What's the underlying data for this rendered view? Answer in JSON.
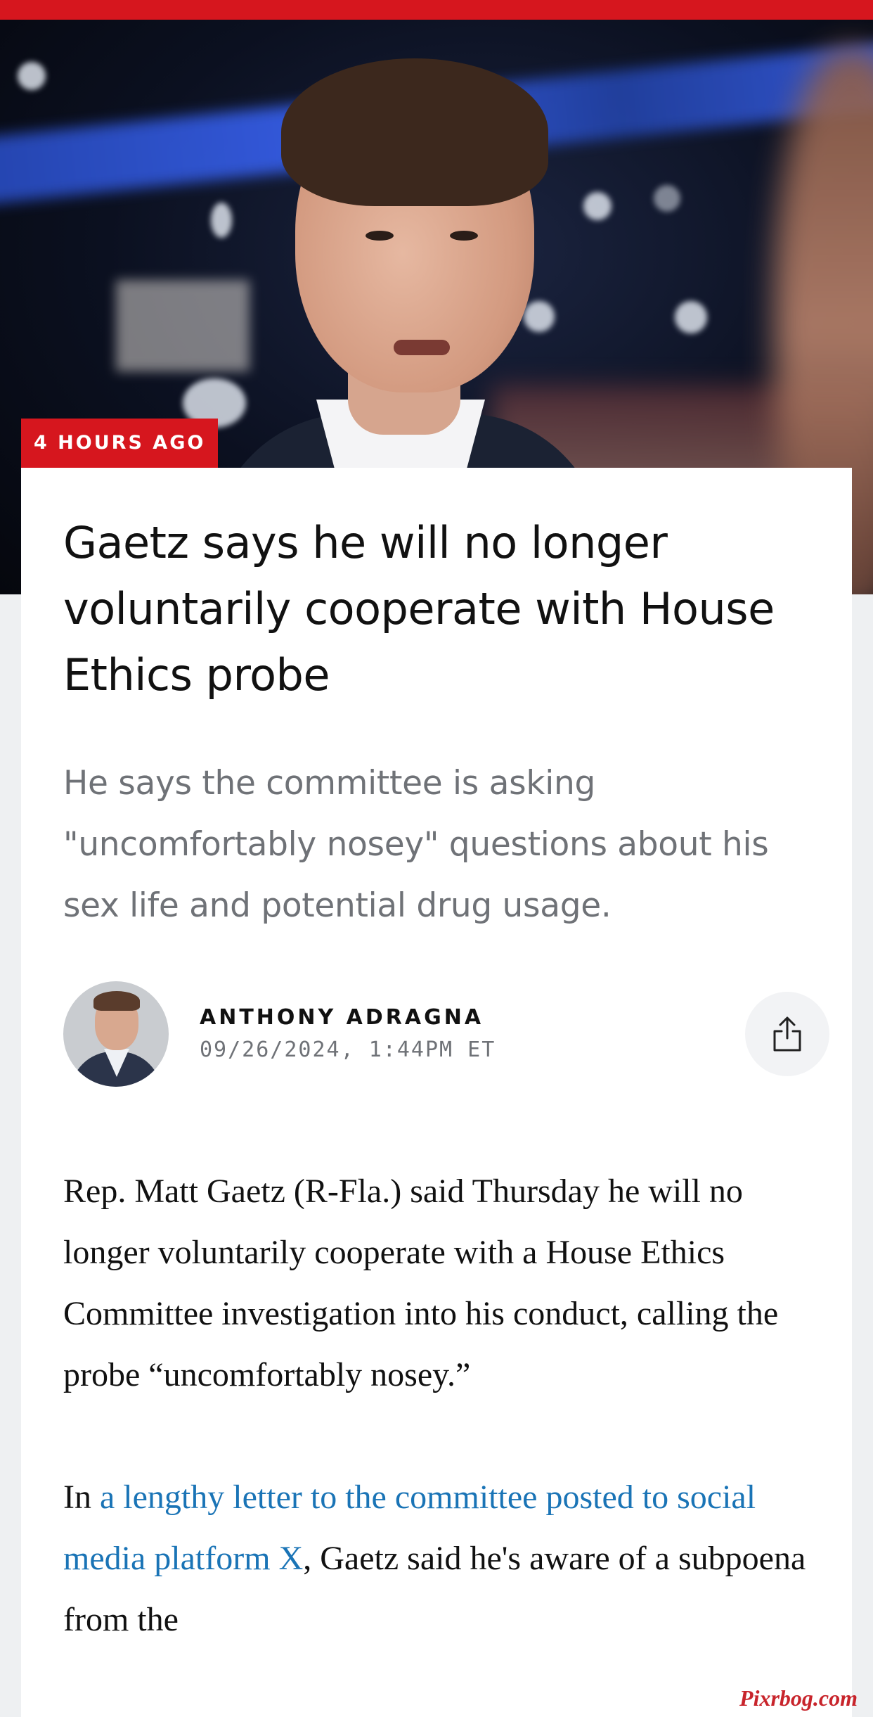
{
  "article": {
    "time_tag": "4 HOURS AGO",
    "headline": "Gaetz says he will no longer voluntarily cooperate with House Ethics probe",
    "subheadline": "He says the committee is asking \"uncomfortably nosey\" questions about his sex life and potential drug usage.",
    "author": {
      "name": "ANTHONY ADRAGNA",
      "date": "09/26/2024, 1:44PM ET",
      "avatar_icon": "author-photo"
    },
    "share_icon": "share-icon",
    "body": {
      "p1": "Rep. Matt Gaetz (R-Fla.) said Thursday he will no longer voluntarily cooperate with a House Ethics Committee investigation into his conduct, calling the probe “uncomfortably nosey.”",
      "p2_prefix": "In ",
      "p2_link": "a lengthy letter to the committee posted to social media platform X",
      "p2_suffix": ", Gaetz said he's aware of a subpoena from the"
    }
  },
  "watermark": "Pixrbog.com",
  "colors": {
    "accent": "#d6161e",
    "link": "#1a74b6",
    "text": "#111111",
    "muted": "#6f7277"
  }
}
